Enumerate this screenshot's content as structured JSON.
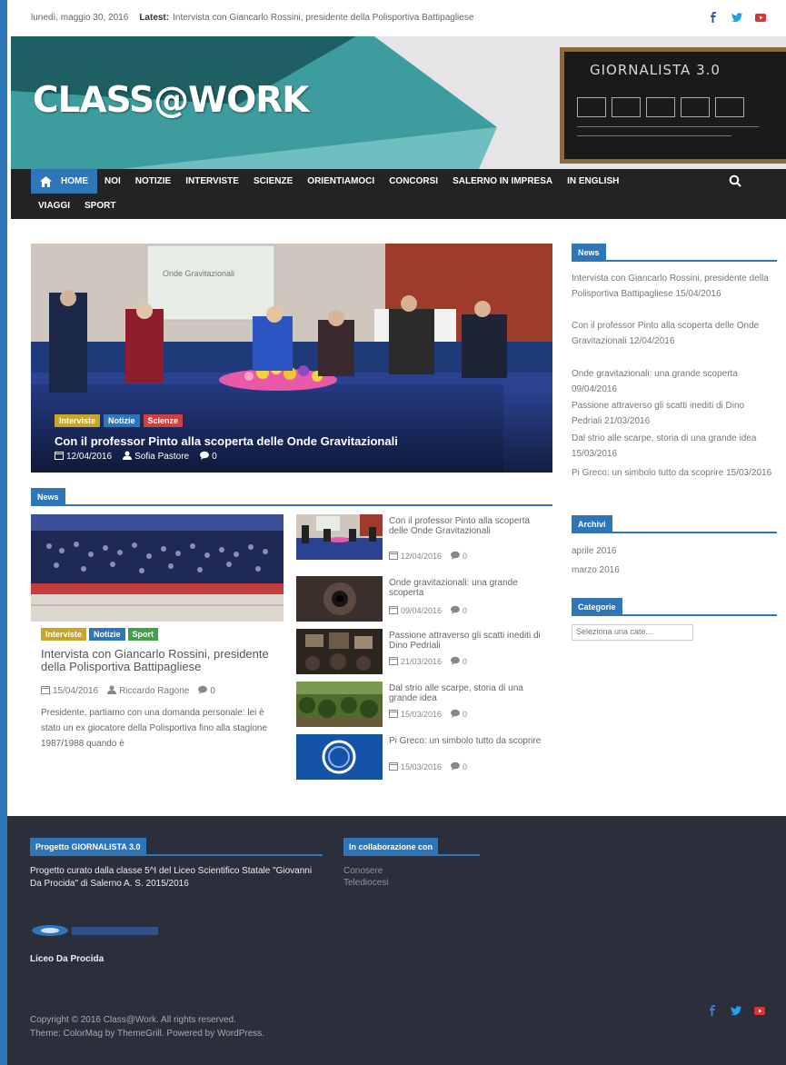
{
  "topbar": {
    "date": "lunedì, maggio 30, 2016",
    "latest_label": "Latest:",
    "latest_link": "Intervista con Giancarlo Rossini, presidente della Polisportiva Battipagliese",
    "socials": [
      "facebook-icon",
      "twitter-icon",
      "youtube-icon"
    ]
  },
  "header": {
    "logo": "CLASS@WORK",
    "chalkboard_title": "GIORNALISTA 3.0"
  },
  "nav": {
    "row1": [
      "HOME",
      "NOI",
      "NOTIZIE",
      "INTERVISTE",
      "SCIENZE",
      "ORIENTIAMOCI",
      "CONCORSI",
      "SALERNO IN IMPRESA",
      "IN ENGLISH"
    ],
    "row2": [
      "VIAGGI",
      "SPORT"
    ]
  },
  "featured": {
    "slide_text": "Onde Gravitazionali",
    "tags": [
      "Interviste",
      "Notizie",
      "Scienze"
    ],
    "title": "Con il professor Pinto alla scoperta delle Onde Gravitazionali",
    "date": "12/04/2016",
    "author": "Sofia Pastore",
    "comments": "0"
  },
  "news_section": {
    "heading": "News",
    "main": {
      "tags": [
        "Interviste",
        "Notizie",
        "Sport"
      ],
      "title": "Intervista con Giancarlo Rossini, presidente della Polisportiva Battipagliese",
      "date": "15/04/2016",
      "author": "Riccardo Ragone",
      "comments": "0",
      "excerpt": "Presidente, partiamo con una domanda personale: lei è stato un ex giocatore della Polisportiva fino alla stagione 1987/1988 quando è"
    },
    "list": [
      {
        "title": "Con il professor Pinto alla scoperta delle Onde Gravitazionali",
        "date": "12/04/2016",
        "comments": "0"
      },
      {
        "title": "Onde gravitazionali: una grande scoperta",
        "date": "09/04/2016",
        "comments": "0"
      },
      {
        "title": "Passione attraverso gli scatti inediti di Dino Pedriali",
        "date": "21/03/2016",
        "comments": "0"
      },
      {
        "title": "Dal strio alle scarpe, storia di una grande idea",
        "date": "15/03/2016",
        "comments": "0"
      },
      {
        "title": "Pi Greco: un simbolo tutto da scoprire",
        "date": "15/03/2016",
        "comments": "0"
      }
    ]
  },
  "sidebar": {
    "news_heading": "News",
    "news_items": [
      "Intervista con Giancarlo Rossini, presidente della Polisportiva Battipagliese 15/04/2016",
      "Con il professor Pinto alla scoperta delle Onde Gravitazionali 12/04/2016",
      "Onde gravitazionali: una grande scoperta 09/04/2016",
      "Passione attraverso gli scatti inediti di Dino Pedriali 21/03/2016",
      "Dal strio alle scarpe, storia di una grande idea 15/03/2016",
      "Pi Greco: un simbolo tutto da scoprire 15/03/2016"
    ],
    "archive_heading": "Archivi",
    "archive_items": [
      "aprile 2016",
      "marzo 2016"
    ],
    "categories_heading": "Categorie",
    "categories_select": "Seleziona una cate..."
  },
  "footer": {
    "col1_heading": "Progetto GIORNALISTA 3.0",
    "col1_text": "Progetto curato dalla classe 5^I del Liceo Scientifico Statale \"Giovanni Da Procida\" di Salerno A. S. 2015/2016",
    "col1_logo_caption": "Liceo Da Procida",
    "col2_heading": "In collaborazione con",
    "col2_links": [
      "Conosere",
      "Telediocesi"
    ],
    "copyright": "Copyright © 2016 Class@Work. All rights reserved.",
    "theme": "Theme: ColorMag by ThemeGrill. Powered by WordPress."
  },
  "colors": {
    "accent": "#2f76b8",
    "nav_bg": "#232323",
    "footer_bg": "#2b2f3c",
    "tag_yellow": "#c8a427",
    "tag_red": "#d14040",
    "tag_green": "#43a047"
  }
}
